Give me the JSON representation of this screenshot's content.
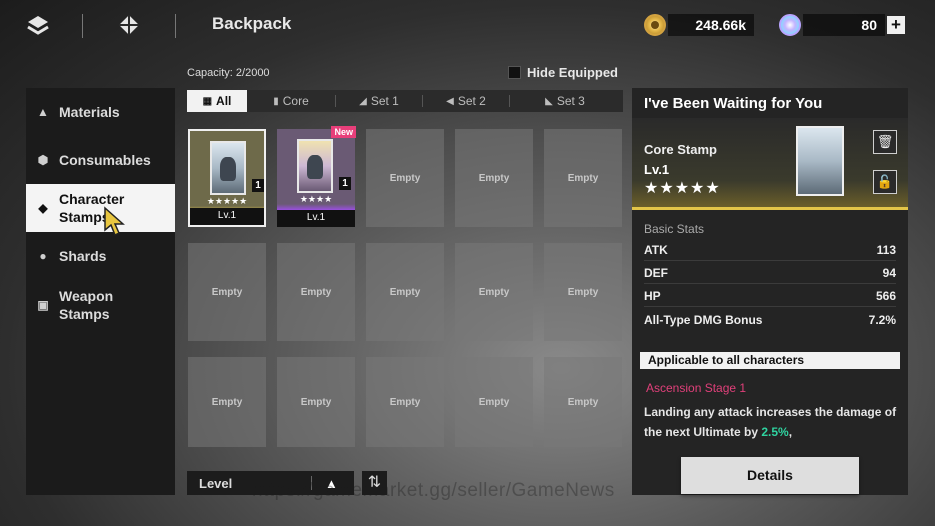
{
  "header": {
    "title": "Backpack",
    "gold_amount": "248.66k",
    "gem_amount": "80",
    "add_label": "+"
  },
  "capacity": "Capacity: 2/2000",
  "hide_equipped_label": "Hide Equipped",
  "sidebar": {
    "items": [
      {
        "label": "Materials",
        "icon": "materials-icon"
      },
      {
        "label": "Consumables",
        "icon": "consumables-icon"
      },
      {
        "label": "Character Stamps",
        "icon": "character-stamps-icon"
      },
      {
        "label": "Shards",
        "icon": "shards-icon"
      },
      {
        "label": "Weapon Stamps",
        "icon": "weapon-stamps-icon"
      }
    ],
    "active_index": 2
  },
  "tabs": [
    {
      "label": "All"
    },
    {
      "label": "Core"
    },
    {
      "label": "Set 1"
    },
    {
      "label": "Set 2"
    },
    {
      "label": "Set 3"
    }
  ],
  "grid": {
    "empty_label": "Empty",
    "cards": [
      {
        "stars": "★★★★★",
        "qty": "1",
        "level": "Lv.1",
        "rarity_color": "#e3c548"
      },
      {
        "stars": "★★★★",
        "qty": "1",
        "level": "Lv.1",
        "badge": "New",
        "rarity_color": "#9a4fe0"
      }
    ]
  },
  "sort": {
    "label": "Level",
    "direction_icon": "triangle-up-icon",
    "toggle_icon": "sort-toggle-icon"
  },
  "detail": {
    "title": "I've Been Waiting for You",
    "type": "Core Stamp",
    "level": "Lv.1",
    "stars": "★★★★★",
    "stats_heading": "Basic Stats",
    "stats": [
      {
        "name": "ATK",
        "value": "113"
      },
      {
        "name": "DEF",
        "value": "94"
      },
      {
        "name": "HP",
        "value": "566"
      },
      {
        "name": "All-Type DMG Bonus",
        "value": "7.2%"
      }
    ],
    "applicable": "Applicable to all characters",
    "ascension": "Ascension Stage 1",
    "desc_before": "Landing any attack increases the damage of the next Ultimate by ",
    "desc_highlight": "2.5%",
    "desc_after": ",",
    "details_button": "Details"
  },
  "watermark": "https://gamemarket.gg/seller/GameNews",
  "colors": {
    "accent_gold": "#e3c548",
    "accent_purple": "#9a4fe0",
    "new_badge": "#e83f7a",
    "ascension_text": "#e0407a",
    "highlight_green": "#2fd3a0"
  }
}
